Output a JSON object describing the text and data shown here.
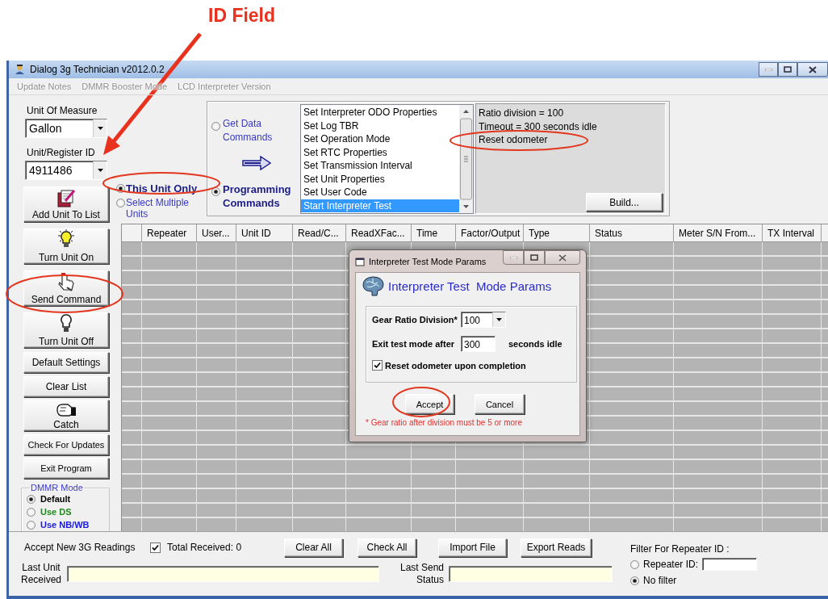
{
  "callout": {
    "label": "ID Field"
  },
  "window": {
    "title": "Dialog 3g Technician v2012.0.2"
  },
  "menu": [
    {
      "label": "Update Notes",
      "disabled": true
    },
    {
      "label": "DMMR Booster Mode",
      "disabled": true
    },
    {
      "label": "LCD Interpreter Version",
      "disabled": true
    }
  ],
  "unit_of_measure": {
    "label": "Unit Of Measure",
    "value": "Gallon"
  },
  "unit_register_id": {
    "label": "Unit/Register ID",
    "value": "4911486"
  },
  "side_buttons": [
    {
      "label": "Add Unit To List",
      "kind": "addlist"
    },
    {
      "label": "Turn Unit On",
      "kind": "bulbon"
    },
    {
      "label": "Send Command",
      "kind": "pointer"
    },
    {
      "label": "Turn Unit Off",
      "kind": "bulboff"
    },
    {
      "label": "Default Settings",
      "kind": "plain"
    },
    {
      "label": "Clear List",
      "kind": "plain"
    },
    {
      "label": "Catch",
      "kind": "grab"
    },
    {
      "label": "Check For Updates",
      "kind": "small"
    },
    {
      "label": "Exit Program",
      "kind": "small"
    }
  ],
  "dmmr_mode": {
    "title": "DMMR Mode",
    "options": [
      {
        "label": "Default",
        "selected": true,
        "color": "#000000"
      },
      {
        "label": "Use DS",
        "selected": false,
        "color": "#1a8a1a"
      },
      {
        "label": "Use NB/WB",
        "selected": false,
        "color": "#1a1ae0"
      }
    ]
  },
  "unit_scope": [
    {
      "label": "This Unit Only",
      "selected": true
    },
    {
      "label": "Select Multiple Units",
      "selected": false
    }
  ],
  "command_type": [
    {
      "label": "Get Data Commands",
      "selected": false
    },
    {
      "label": "Programming Commands",
      "selected": true
    }
  ],
  "commands": [
    {
      "label": "Set Interpreter ODO Properties",
      "selected": false
    },
    {
      "label": "Set Log TBR",
      "selected": false
    },
    {
      "label": "Set Operation Mode",
      "selected": false
    },
    {
      "label": "Set RTC Properties",
      "selected": false
    },
    {
      "label": "Set Transmission Interval",
      "selected": false
    },
    {
      "label": "Set Unit Properties",
      "selected": false
    },
    {
      "label": "Set User Code",
      "selected": false
    },
    {
      "label": "Start Interpreter Test",
      "selected": true
    }
  ],
  "command_summary": [
    "Ratio division = 100",
    "Timeout = 300 seconds idle",
    "Reset odometer"
  ],
  "build_button": "Build...",
  "table": {
    "columns": [
      "Repeater",
      "User...",
      "Unit ID",
      "Read/C...",
      "ReadXFac...",
      "Time",
      "Factor/Output",
      "Type",
      "Status",
      "Meter S/N From...",
      "TX Interval"
    ]
  },
  "dialog": {
    "title": "Interpreter Test Mode Params",
    "heading": "Interpreter Test  Mode Params",
    "gear_ratio": {
      "label": "Gear Ratio Division*",
      "value": "100"
    },
    "exit_after": {
      "label": "Exit test mode after",
      "value": "300",
      "unit": "seconds idle"
    },
    "reset_odometer": {
      "label": "Reset odometer upon completion",
      "checked": true
    },
    "buttons": [
      "Accept",
      "Cancel"
    ],
    "note": "* Gear ratio after division must be 5 or more"
  },
  "footer": {
    "accept_new": {
      "label": "Accept New 3G Readings",
      "checked": true
    },
    "total_received": "Total Received: 0",
    "buttons": [
      "Clear All",
      "Check All",
      "Import File",
      "Export Reads"
    ],
    "last_unit": {
      "label": "Last Unit Received"
    },
    "last_send": {
      "label": "Last Send Status"
    },
    "filter": {
      "title": "Filter For Repeater ID :",
      "options": [
        {
          "label": "Repeater ID:",
          "selected": false,
          "kind": "input"
        },
        {
          "label": "No filter",
          "selected": true,
          "kind": "plain"
        }
      ]
    }
  }
}
